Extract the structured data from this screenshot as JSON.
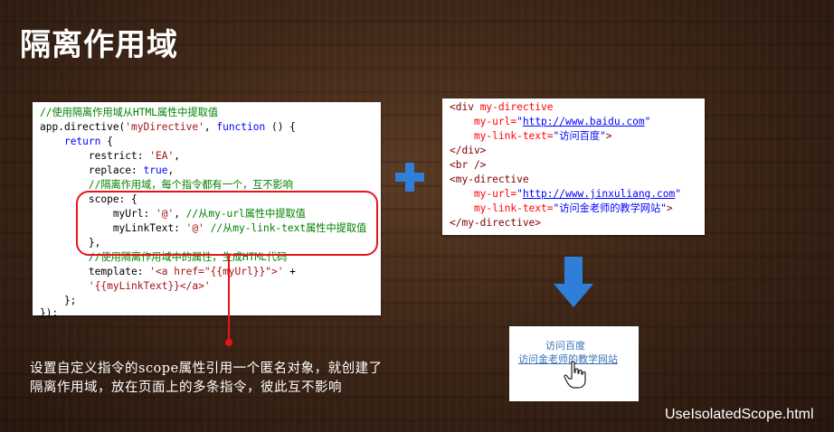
{
  "slide": {
    "title": "隔离作用域",
    "filename": "UseIsolatedScope.html",
    "description": [
      "设置自定义指令的scope属性引用一个匿名对象，就创建了",
      "隔离作用域，放在页面上的多条指令，彼此互不影响"
    ]
  },
  "left_code": {
    "l1": "//使用隔离作用域从HTML属性中提取值",
    "l2a": "app.directive(",
    "l2b": "'myDirective'",
    "l2c": ", ",
    "l2d": "function",
    "l2e": " () {",
    "l3a": "    ",
    "l3b": "return",
    "l3c": " {",
    "l4a": "        restrict: ",
    "l4b": "'EA'",
    "l4c": ",",
    "l5a": "        replace: ",
    "l5b": "true",
    "l5c": ",",
    "l6": "        //隔离作用域，每个指令都有一个，互不影响",
    "l7": "        scope: {",
    "l8a": "            myUrl: ",
    "l8b": "'@'",
    "l8c": ", ",
    "l8d": "//从my-url属性中提取值",
    "l9a": "            myLinkText: ",
    "l9b": "'@'",
    "l9c": " ",
    "l9d": "//从my-link-text属性中提取值",
    "l10": "        },",
    "l11": "        //使用隔离作用域中的属性，生成HTML代码",
    "l12a": "        template: ",
    "l12b": "'<a href=\"{{myUrl}}\">'",
    "l12c": " +",
    "l13a": "        ",
    "l13b": "'{{myLinkText}}</a>'",
    "l14": "    };",
    "l15": "});"
  },
  "right_code": {
    "r1a": "<div ",
    "r1b": "my-directive",
    "r2a": "    my-url=",
    "r2q1": "\"",
    "r2b": "http://www.baidu.com",
    "r2q2": "\"",
    "r3a": "    my-link-text=",
    "r3b": "\"访问百度\"",
    "r3c": ">",
    "r4": "</div>",
    "r5": "<br />",
    "r6a": "<my-directive",
    "r7a": "    my-url=",
    "r7q1": "\"",
    "r7b": "http://www.jinxuliang.com",
    "r7q2": "\"",
    "r8a": "    my-link-text=",
    "r8b": "\"访问金老师的教学网站\"",
    "r8c": ">",
    "r9": "</my-directive>"
  },
  "result": {
    "link1": "访问百度",
    "link2": "访问金老师的教学网站"
  },
  "colors": {
    "highlight": "#e8141b",
    "accent_blue": "#2f7fd8"
  },
  "icons": [
    "plus-icon",
    "down-arrow-icon",
    "hand-cursor-icon"
  ]
}
